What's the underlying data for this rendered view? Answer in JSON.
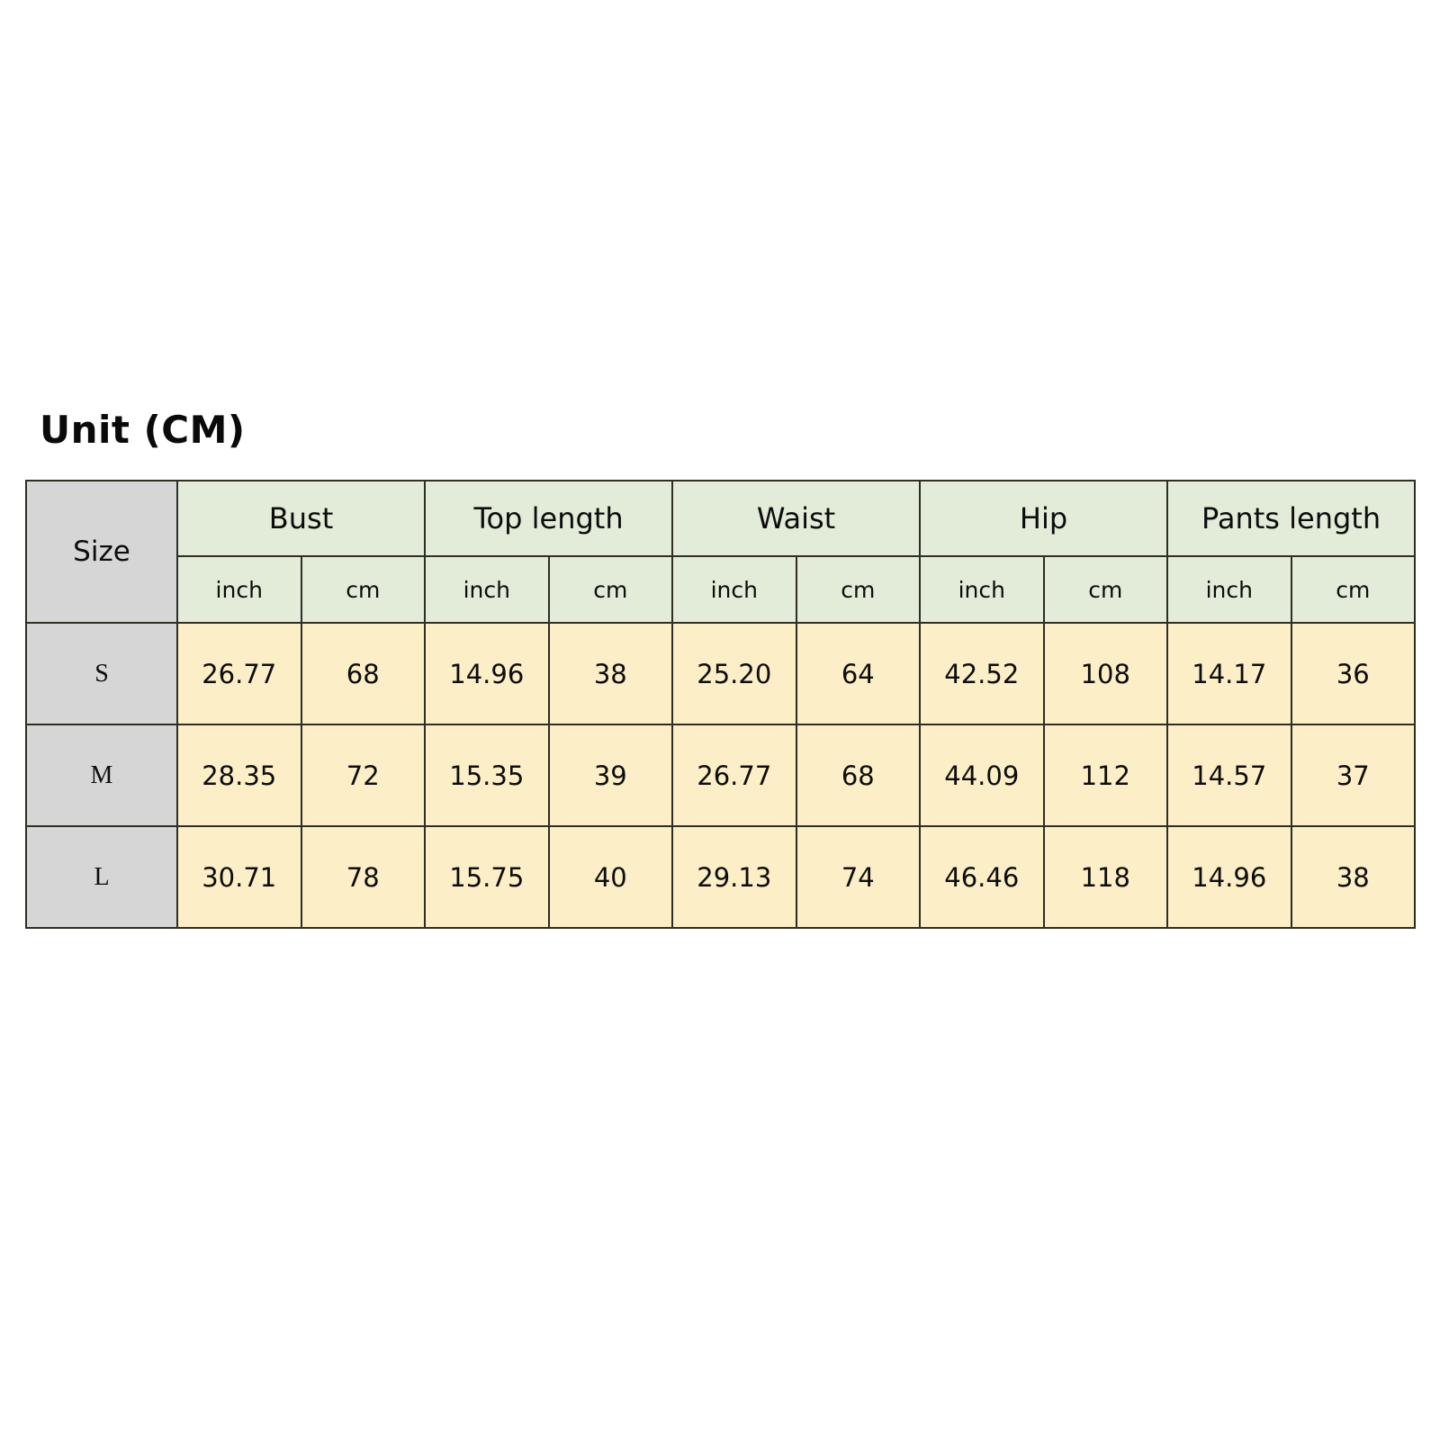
{
  "title": "Unit (CM)",
  "table": {
    "size_header": "Size",
    "groups": [
      {
        "label": "Bust"
      },
      {
        "label": "Top length"
      },
      {
        "label": "Waist"
      },
      {
        "label": "Hip"
      },
      {
        "label": "Pants length"
      }
    ],
    "units": [
      "inch",
      "cm",
      "inch",
      "cm",
      "inch",
      "cm",
      "inch",
      "cm",
      "inch",
      "cm"
    ],
    "rows": [
      {
        "size": "S",
        "values": [
          "26.77",
          "68",
          "14.96",
          "38",
          "25.20",
          "64",
          "42.52",
          "108",
          "14.17",
          "36"
        ]
      },
      {
        "size": "M",
        "values": [
          "28.35",
          "72",
          "15.35",
          "39",
          "26.77",
          "68",
          "44.09",
          "112",
          "14.57",
          "37"
        ]
      },
      {
        "size": "L",
        "values": [
          "30.71",
          "78",
          "15.75",
          "40",
          "29.13",
          "74",
          "46.46",
          "118",
          "14.96",
          "38"
        ]
      }
    ]
  },
  "colors": {
    "group_header_bg": "#e2ecd9",
    "size_column_bg": "#d6d6d6",
    "data_cell_bg": "#fceec6",
    "border": "#2e2e24",
    "text": "#0d0d0d",
    "page_bg": "#ffffff"
  },
  "chart_data": {
    "type": "table",
    "title": "Unit (CM)",
    "columns": [
      "Size",
      "Bust inch",
      "Bust cm",
      "Top length inch",
      "Top length cm",
      "Waist inch",
      "Waist cm",
      "Hip inch",
      "Hip cm",
      "Pants length inch",
      "Pants length cm"
    ],
    "rows": [
      [
        "S",
        26.77,
        68,
        14.96,
        38,
        25.2,
        64,
        42.52,
        108,
        14.17,
        36
      ],
      [
        "M",
        28.35,
        72,
        15.35,
        39,
        26.77,
        68,
        44.09,
        112,
        14.57,
        37
      ],
      [
        "L",
        30.71,
        78,
        15.75,
        40,
        29.13,
        74,
        46.46,
        118,
        14.96,
        38
      ]
    ]
  }
}
